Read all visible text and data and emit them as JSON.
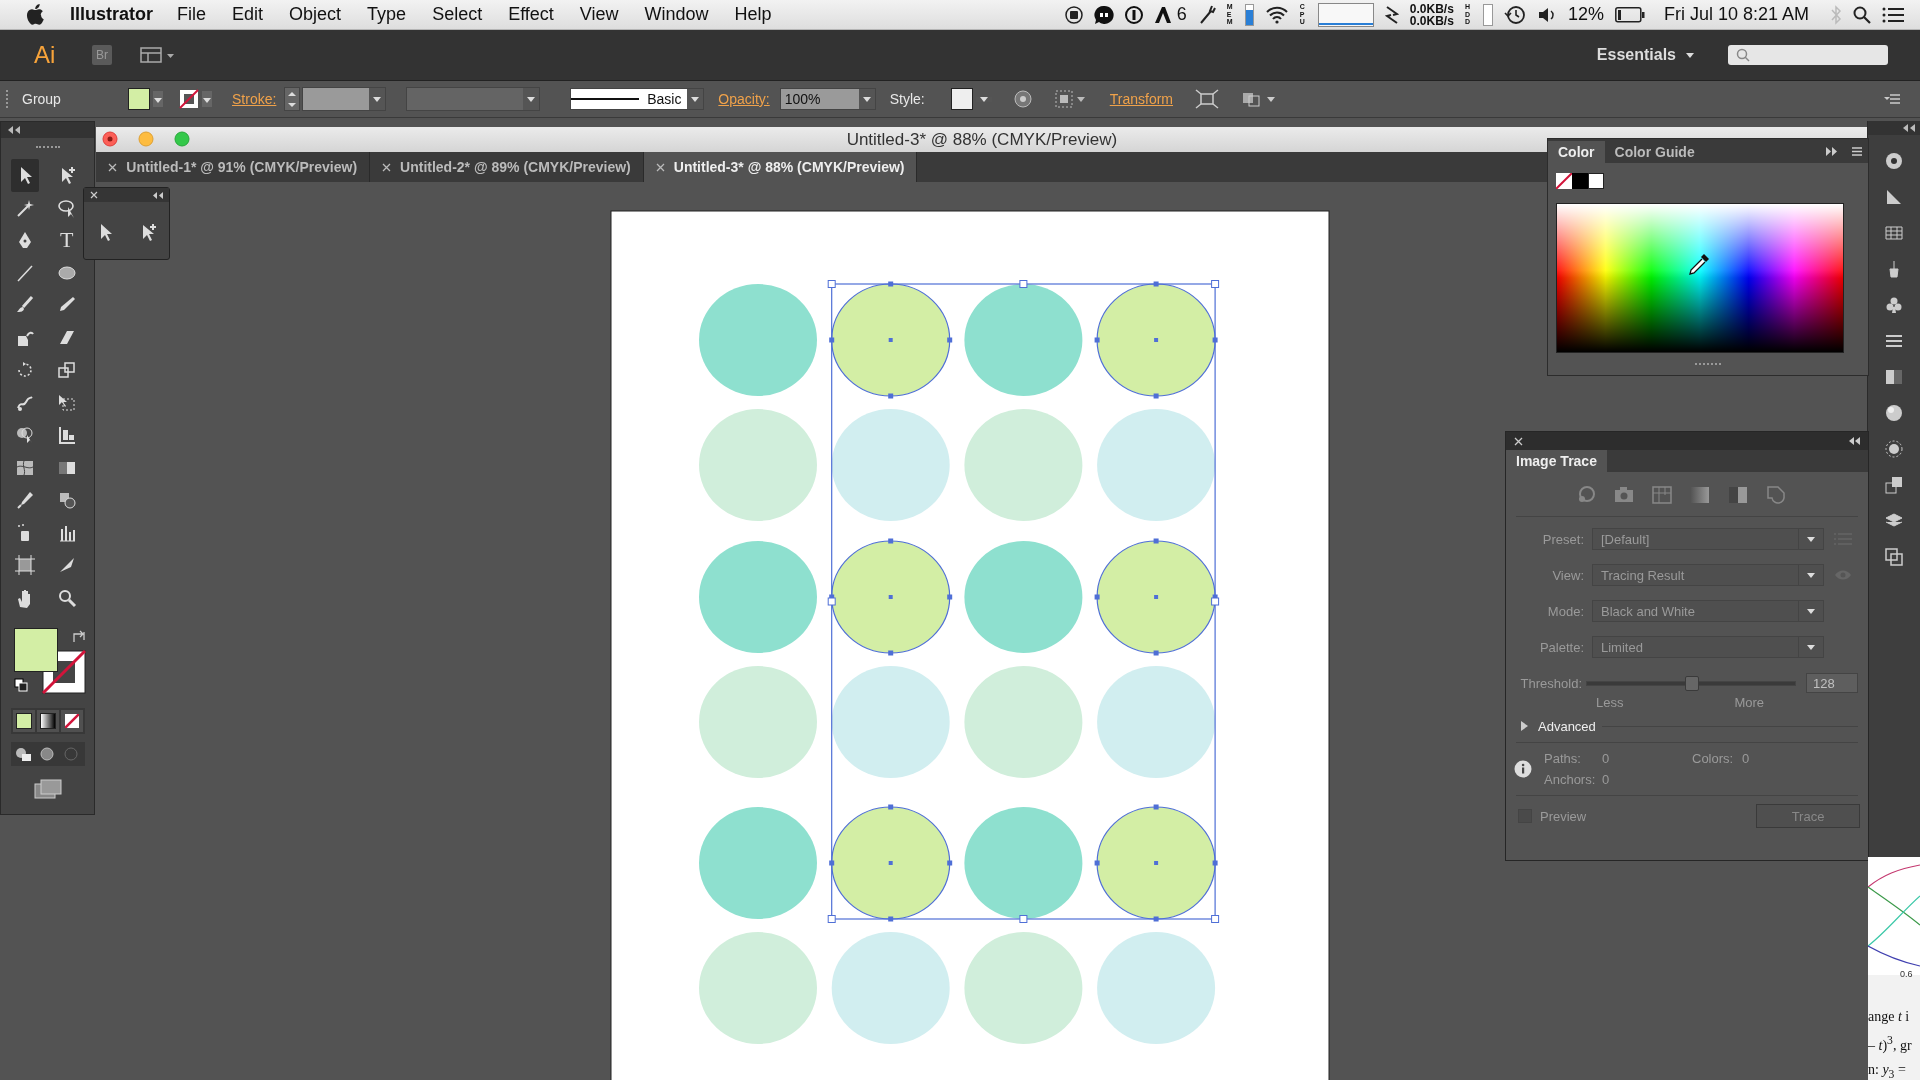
{
  "menu_bar": {
    "app_name": "Illustrator",
    "items": [
      "File",
      "Edit",
      "Object",
      "Type",
      "Select",
      "Effect",
      "View",
      "Window",
      "Help"
    ],
    "adobe_count": "6",
    "mem_label": "MEM",
    "cpu_label": "CPU",
    "net_up": "0.0KB/s",
    "net_down": "0.0KB/s",
    "hdd_label": "HDD",
    "battery": "12%",
    "clock": "Fri Jul 10  8:21 AM"
  },
  "app_bar": {
    "logo": "Ai",
    "bridge": "Br",
    "workspace": "Essentials"
  },
  "control_bar": {
    "selection": "Group",
    "stroke_label": "Stroke:",
    "brush": "Basic",
    "opacity_label": "Opacity:",
    "opacity": "100%",
    "style_label": "Style:",
    "transform": "Transform"
  },
  "toolbar": {
    "tools": [
      {
        "selected": true
      },
      {
        "selected": false
      },
      {
        "selected": false
      },
      {
        "selected": false
      },
      {
        "selected": false
      },
      {
        "selected": false,
        "label": "T"
      },
      {
        "selected": false
      },
      {
        "selected": false
      },
      {
        "selected": false
      },
      {
        "selected": false
      },
      {
        "selected": false
      },
      {
        "selected": false
      },
      {
        "selected": false
      },
      {
        "selected": false
      },
      {
        "selected": false
      },
      {
        "selected": false
      },
      {
        "selected": false
      },
      {
        "selected": false
      },
      {
        "selected": false
      },
      {
        "selected": false
      },
      {
        "selected": false
      },
      {
        "selected": false
      },
      {
        "selected": false
      },
      {
        "selected": false
      },
      {
        "selected": false
      },
      {
        "selected": false
      },
      {
        "selected": false
      },
      {
        "selected": false
      }
    ]
  },
  "document": {
    "title": "Untitled-3* @ 88% (CMYK/Preview)",
    "tabs": [
      {
        "label": "Untitled-1* @ 91% (CMYK/Preview)",
        "selected": false
      },
      {
        "label": "Untitled-2* @ 89% (CMYK/Preview)",
        "selected": false
      },
      {
        "label": "Untitled-3* @ 88% (CMYK/Preview)",
        "selected": true
      }
    ],
    "circles": [
      {
        "color": "#8ee0cf",
        "selected": false
      },
      {
        "color": "#d3eea5",
        "selected": true
      },
      {
        "color": "#8ee0cf",
        "selected": false
      },
      {
        "color": "#d3eea5",
        "selected": true
      },
      {
        "color": "#d0eedb",
        "selected": false
      },
      {
        "color": "#d1eef0",
        "selected": false
      },
      {
        "color": "#d0eedb",
        "selected": false
      },
      {
        "color": "#d1eef0",
        "selected": false
      },
      {
        "color": "#8ee0cf",
        "selected": false
      },
      {
        "color": "#d3eea5",
        "selected": true
      },
      {
        "color": "#8ee0cf",
        "selected": false
      },
      {
        "color": "#d3eea5",
        "selected": true
      },
      {
        "color": "#d0eedb",
        "selected": false
      },
      {
        "color": "#d1eef0",
        "selected": false
      },
      {
        "color": "#d0eedb",
        "selected": false
      },
      {
        "color": "#d1eef0",
        "selected": false
      },
      {
        "color": "#8ee0cf",
        "selected": false
      },
      {
        "color": "#d3eea5",
        "selected": true
      },
      {
        "color": "#8ee0cf",
        "selected": false
      },
      {
        "color": "#d3eea5",
        "selected": true
      },
      {
        "color": "#d0eedb",
        "selected": false
      },
      {
        "color": "#d1eef0",
        "selected": false
      },
      {
        "color": "#d0eedb",
        "selected": false
      },
      {
        "color": "#d1eef0",
        "selected": false
      }
    ]
  },
  "color_panel": {
    "tabs": [
      {
        "label": "Color",
        "selected": true
      },
      {
        "label": "Color Guide",
        "selected": false
      }
    ]
  },
  "image_trace": {
    "title": "Image Trace",
    "disabled": true,
    "fields": [
      {
        "label": "Preset:",
        "value": "[Default]"
      },
      {
        "label": "View:",
        "value": "Tracing Result"
      },
      {
        "label": "Mode:",
        "value": "Black and White"
      },
      {
        "label": "Palette:",
        "value": "Limited"
      }
    ],
    "threshold": {
      "label": "Threshold:",
      "level": 0.5,
      "value": "128",
      "min_label": "Less",
      "max_label": "More"
    },
    "advanced": {
      "label": "Advanced",
      "expanded": false
    },
    "stats": {
      "paths_label": "Paths:",
      "paths": "0",
      "colors_label": "Colors:",
      "colors": "0",
      "anchors_label": "Anchors:",
      "anchors": "0"
    },
    "preview": {
      "label": "Preview",
      "checked": false
    },
    "trace_button": "Trace"
  },
  "background_window": {
    "tick": "0.6",
    "lines": [
      "ange *t* i",
      "– *t*)$^{3}$, gr",
      "n: *y*$_{3}$ ="
    ]
  }
}
